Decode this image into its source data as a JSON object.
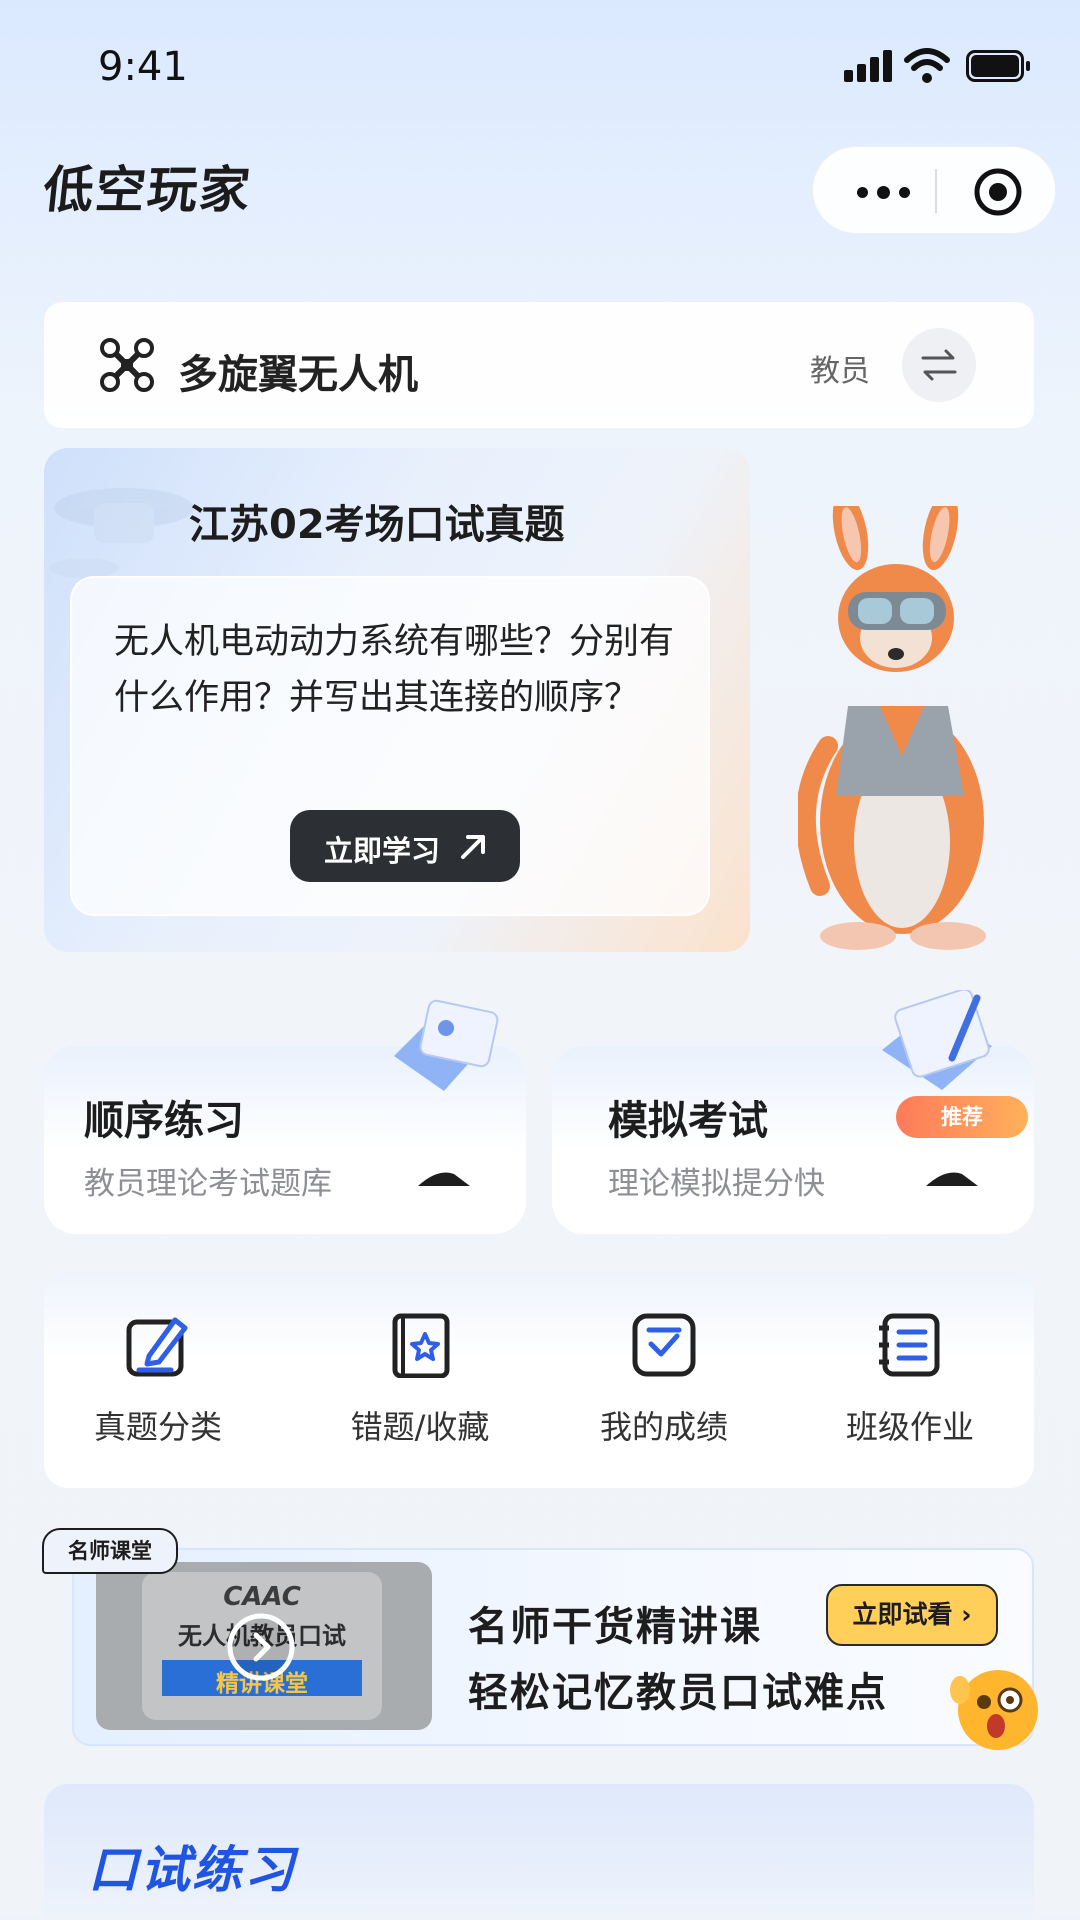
{
  "status": {
    "time": "9:41"
  },
  "header": {
    "title": "低空玩家"
  },
  "category": {
    "label": "多旋翼无人机",
    "role": "教员"
  },
  "feature": {
    "title": "江苏02考场口试真题",
    "question": "无人机电动动力系统有哪些？分别有什么作用？并写出其连接的顺序？",
    "button_label": "立即学习"
  },
  "practice": [
    {
      "title": "顺序练习",
      "subtitle": "教员理论考试题库"
    },
    {
      "title": "模拟考试",
      "subtitle": "理论模拟提分快",
      "badge": "推荐"
    }
  ],
  "tools": [
    {
      "label": "真题分类",
      "icon": "edit-icon"
    },
    {
      "label": "错题/收藏",
      "icon": "book-star-icon"
    },
    {
      "label": "我的成绩",
      "icon": "checklist-icon"
    },
    {
      "label": "班级作业",
      "icon": "notebook-icon"
    }
  ],
  "banner": {
    "tag": "名师课堂",
    "thumb_line1": "CAAC",
    "thumb_line2": "无人机教员口试",
    "thumb_line3": "精讲课堂",
    "line1": "名师干货精讲课",
    "line2": "轻松记忆教员口试难点",
    "button_label": "立即试看"
  },
  "oral": {
    "title": "口试练习"
  },
  "colors": {
    "accent_blue": "#1f55e0",
    "dark_button": "#2c2f33",
    "badge_orange": "#ff7a5a",
    "try_yellow": "#ffcf5a"
  }
}
